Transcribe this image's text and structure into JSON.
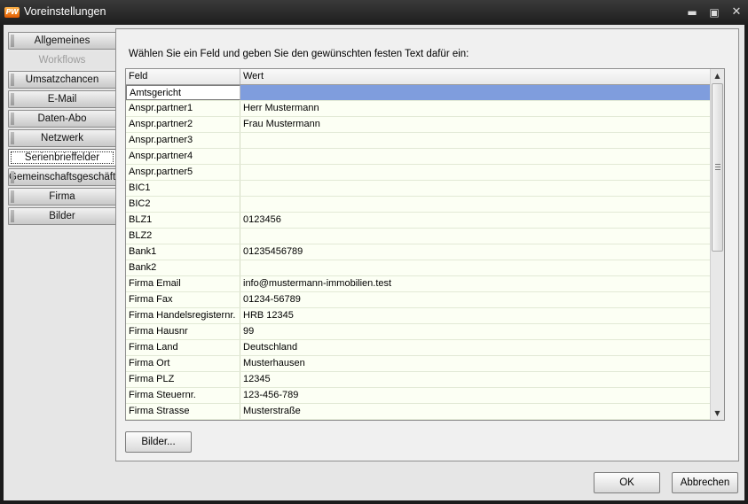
{
  "window": {
    "title": "Voreinstellungen",
    "logo_text": "PW"
  },
  "nav": {
    "items": [
      {
        "label": "Allgemeines",
        "state": "normal"
      },
      {
        "label": "Workflows",
        "state": "disabled"
      },
      {
        "label": "Umsatzchancen",
        "state": "normal"
      },
      {
        "label": "E-Mail",
        "state": "normal"
      },
      {
        "label": "Daten-Abo",
        "state": "normal"
      },
      {
        "label": "Netzwerk",
        "state": "normal"
      },
      {
        "label": "Serienbrieffelder",
        "state": "active"
      },
      {
        "label": "Gemeinschaftsgeschäft",
        "state": "normal"
      },
      {
        "label": "Firma",
        "state": "normal"
      },
      {
        "label": "Bilder",
        "state": "normal"
      }
    ]
  },
  "main": {
    "instruction": "Wählen Sie ein Feld und geben Sie den gewünschten festen Text dafür ein:",
    "table": {
      "columns": [
        "Feld",
        "Wert"
      ],
      "selected_row": 0,
      "rows": [
        {
          "feld": "Amtsgericht",
          "wert": ""
        },
        {
          "feld": "Anspr.partner1",
          "wert": "Herr Mustermann"
        },
        {
          "feld": "Anspr.partner2",
          "wert": "Frau Mustermann"
        },
        {
          "feld": "Anspr.partner3",
          "wert": ""
        },
        {
          "feld": "Anspr.partner4",
          "wert": ""
        },
        {
          "feld": "Anspr.partner5",
          "wert": ""
        },
        {
          "feld": "BIC1",
          "wert": ""
        },
        {
          "feld": "BIC2",
          "wert": ""
        },
        {
          "feld": "BLZ1",
          "wert": "0123456"
        },
        {
          "feld": "BLZ2",
          "wert": ""
        },
        {
          "feld": "Bank1",
          "wert": "01235456789"
        },
        {
          "feld": "Bank2",
          "wert": ""
        },
        {
          "feld": "Firma Email",
          "wert": "info@mustermann-immobilien.test"
        },
        {
          "feld": "Firma Fax",
          "wert": "01234-56789"
        },
        {
          "feld": "Firma Handelsregisternr.",
          "wert": "HRB 12345"
        },
        {
          "feld": "Firma Hausnr",
          "wert": "99"
        },
        {
          "feld": "Firma Land",
          "wert": "Deutschland"
        },
        {
          "feld": "Firma Ort",
          "wert": "Musterhausen"
        },
        {
          "feld": "Firma PLZ",
          "wert": "12345"
        },
        {
          "feld": "Firma Steuernr.",
          "wert": "123-456-789"
        },
        {
          "feld": "Firma Strasse",
          "wert": "Musterstraße"
        }
      ]
    },
    "bilder_button": "Bilder..."
  },
  "footer": {
    "ok_label": "OK",
    "cancel_label": "Abbrechen"
  },
  "colors": {
    "selection": "#7f9ddd",
    "row_background": "#fcfff4",
    "title_bar": "#1e1e1e"
  }
}
